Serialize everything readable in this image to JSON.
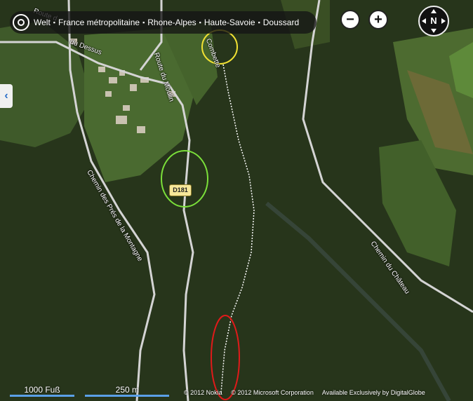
{
  "breadcrumb": {
    "items": [
      "Welt",
      "France métropolitaine",
      "Rhone-Alpes",
      "Haute-Savoie",
      "Doussard"
    ],
    "separator": "▪"
  },
  "controls": {
    "zoom_out": "−",
    "zoom_in": "+",
    "compass": "N",
    "side_tab": "‹"
  },
  "road_badge": "D181",
  "streets": {
    "route_d_top": "Route d",
    "du_dessus": "du Dessus",
    "route_du_moulin": "Route du Moulin",
    "combette": "Combette",
    "chemin_pres": "Chemin des Prés de la Montagne",
    "chemin_chateau": "Chemin du Château"
  },
  "scale": {
    "feet": "1000 Fuß",
    "meters": "250 m"
  },
  "credits": {
    "nokia": "© 2012 Nokia",
    "microsoft": "© 2012 Microsoft Corporation",
    "digitalglobe": "Available Exclusively by DigitalGlobe"
  },
  "colors": {
    "forest": "#243019",
    "meadow": "#4d6b35",
    "road": "#d8d8d8",
    "annotation_yellow": "#f2e233",
    "annotation_green": "#7be03a",
    "annotation_red": "#e01a1a",
    "scale_bar": "#5aa0e8"
  }
}
